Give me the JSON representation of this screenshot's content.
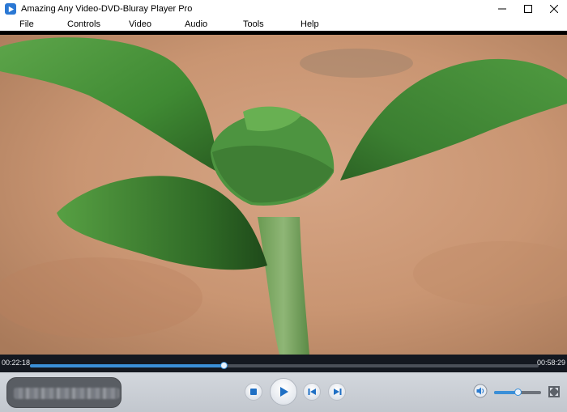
{
  "window": {
    "title": "Amazing Any Video-DVD-Bluray Player Pro",
    "app_icon": "play-icon",
    "controls": [
      "minimize-icon",
      "maximize-icon",
      "close-icon"
    ]
  },
  "menu": {
    "items": [
      {
        "label": "File"
      },
      {
        "label": "Controls"
      },
      {
        "label": "Video"
      },
      {
        "label": "Audio"
      },
      {
        "label": "Tools"
      },
      {
        "label": "Help"
      }
    ]
  },
  "playback": {
    "elapsed": "00:22:18",
    "total": "00:58:29",
    "progress_fraction": 0.38
  },
  "now_playing": {
    "label": "",
    "obscured": true
  },
  "controls": {
    "stop_icon": "stop-icon",
    "play_icon": "play-icon",
    "previous_icon": "skip-previous-icon",
    "next_icon": "skip-next-icon"
  },
  "volume": {
    "icon": "volume-icon",
    "level_fraction": 0.5
  },
  "fullscreen_icon": "fullscreen-icon",
  "colors": {
    "accent": "#3a8fd8",
    "control_bar": "#c9cdd3",
    "progress_bg": "#141820"
  }
}
